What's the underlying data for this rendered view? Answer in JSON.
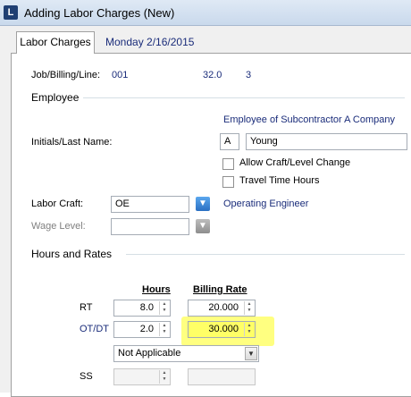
{
  "window": {
    "title": "Adding Labor Charges  (New)",
    "icon_letter": "L"
  },
  "tabs": [
    {
      "label": "Labor Charges"
    }
  ],
  "tab_date": "Monday  2/16/2015",
  "job_line": {
    "label": "Job/Billing/Line:",
    "job": "001",
    "hours": "32.0",
    "line": "3"
  },
  "employee": {
    "section_title": "Employee",
    "company": "Employee of Subcontractor A Company",
    "initials_label": "Initials/Last Name:",
    "initials": "A",
    "last_name": "Young",
    "allow_craft_change": "Allow Craft/Level Change",
    "travel_time": "Travel Time Hours",
    "labor_craft_label": "Labor Craft:",
    "labor_craft_value": "OE",
    "labor_craft_desc": "Operating Engineer",
    "wage_level_label": "Wage Level:",
    "wage_level_value": ""
  },
  "hours_rates": {
    "section_title": "Hours and Rates",
    "col_hours": "Hours",
    "col_billing": "Billing Rate",
    "rows": [
      {
        "label": "RT",
        "hours": "8.0",
        "rate": "20.000"
      },
      {
        "label": "OT/DT",
        "hours": "2.0",
        "rate": "30.000"
      }
    ],
    "ot_type": "Not Applicable",
    "ss_label": "SS",
    "ss_hours": "",
    "ss_rate": ""
  },
  "colors": {
    "label_blue": "#1a2c7a",
    "highlight": "#ffff80"
  }
}
